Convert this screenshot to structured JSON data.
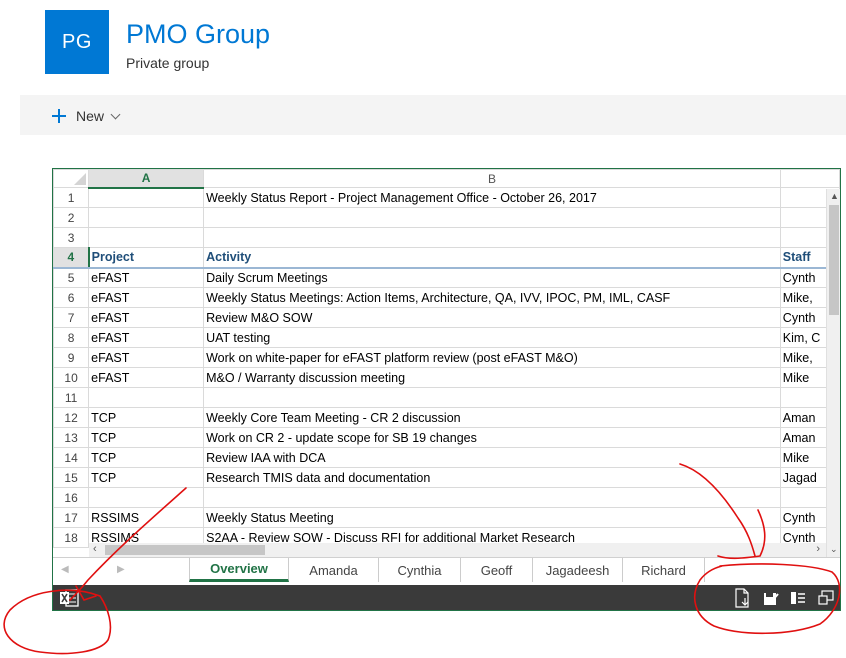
{
  "group": {
    "initials": "PG",
    "title": "PMO Group",
    "subtitle": "Private group"
  },
  "command_bar": {
    "new_label": "New"
  },
  "sheet": {
    "columns": [
      "A",
      "B"
    ],
    "rows": [
      {
        "num": "1",
        "a": "",
        "b": "Weekly Status Report - Project Management Office - October 26, 2017",
        "c": ""
      },
      {
        "num": "2",
        "a": "",
        "b": "",
        "c": ""
      },
      {
        "num": "3",
        "a": "",
        "b": "",
        "c": ""
      },
      {
        "num": "4",
        "a": "Project",
        "b": "Activity",
        "c": "Staff"
      },
      {
        "num": "5",
        "a": "eFAST",
        "b": "Daily Scrum Meetings",
        "c": "Cynth"
      },
      {
        "num": "6",
        "a": "eFAST",
        "b": "Weekly Status Meetings: Action Items, Architecture, QA, IVV, IPOC, PM, IML, CASF",
        "c": "Mike,"
      },
      {
        "num": "7",
        "a": "eFAST",
        "b": "Review M&O SOW",
        "c": "Cynth"
      },
      {
        "num": "8",
        "a": "eFAST",
        "b": "UAT testing",
        "c": "Kim, C"
      },
      {
        "num": "9",
        "a": "eFAST",
        "b": "Work on white-paper for eFAST platform review (post eFAST M&O)",
        "c": "Mike,"
      },
      {
        "num": "10",
        "a": "eFAST",
        "b": "M&O / Warranty discussion meeting",
        "c": "Mike"
      },
      {
        "num": "11",
        "a": "",
        "b": "",
        "c": ""
      },
      {
        "num": "12",
        "a": "TCP",
        "b": "Weekly Core Team Meeting - CR 2 discussion",
        "c": "Aman"
      },
      {
        "num": "13",
        "a": "TCP",
        "b": "Work on CR 2 - update scope for SB 19 changes",
        "c": "Aman"
      },
      {
        "num": "14",
        "a": "TCP",
        "b": "Review IAA with DCA",
        "c": "Mike"
      },
      {
        "num": "15",
        "a": "TCP",
        "b": "Research TMIS data and documentation",
        "c": "Jagad"
      },
      {
        "num": "16",
        "a": "",
        "b": "",
        "c": ""
      },
      {
        "num": "17",
        "a": "RSSIMS",
        "b": "Weekly Status Meeting",
        "c": "Cynth"
      },
      {
        "num": "18",
        "a": "RSSIMS",
        "b": "S2AA - Review SOW - Discuss RFI for additional Market Research",
        "c": "Cynth"
      }
    ]
  },
  "tabs": [
    {
      "label": "Overview",
      "active": true
    },
    {
      "label": "Amanda"
    },
    {
      "label": "Cynthia"
    },
    {
      "label": "Geoff"
    },
    {
      "label": "Jagadeesh"
    },
    {
      "label": "Richard"
    }
  ],
  "colors": {
    "brand_blue": "#0078d4",
    "excel_green": "#217346",
    "annotation_red": "#e01010"
  },
  "icons": {
    "excel": "excel-logo-icon",
    "download": "download-document-icon",
    "save": "save-edit-icon",
    "reading_view": "reading-view-icon",
    "fullscreen": "popout-icon"
  }
}
